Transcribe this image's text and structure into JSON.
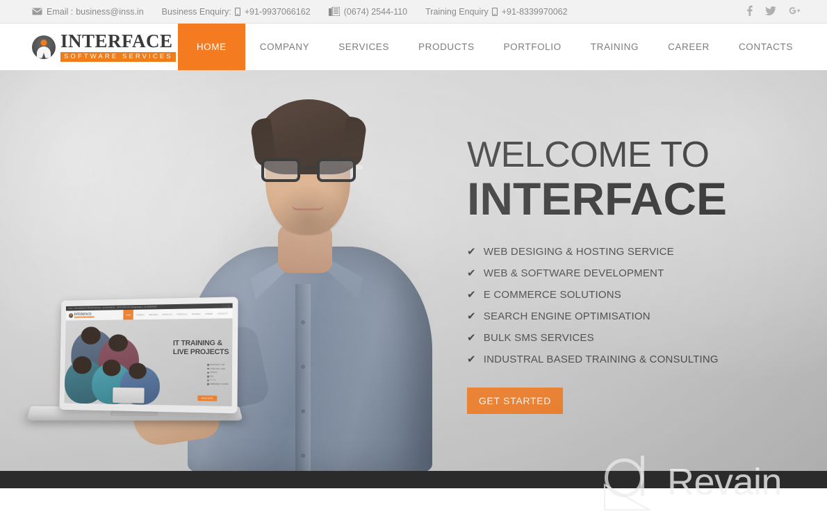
{
  "topbar": {
    "email_label": "Email :",
    "email_value": "business@inss.in",
    "business_label": "Business Enquiry:",
    "business_value": "+91-9937066162",
    "landline_value": "(0674) 2544-110",
    "training_label": "Training Enquiry",
    "training_value": "+91-8339970062",
    "social": [
      {
        "name": "facebook-icon",
        "glyph": "f"
      },
      {
        "name": "twitter-icon",
        "glyph": "ᵗ"
      },
      {
        "name": "google-plus-icon",
        "glyph": "g+"
      }
    ]
  },
  "logo": {
    "title": "INTERFACE",
    "subtitle": "SOFTWARE SERVICES"
  },
  "nav": {
    "items": [
      {
        "label": "HOME",
        "active": true
      },
      {
        "label": "COMPANY",
        "active": false
      },
      {
        "label": "SERVICES",
        "active": false
      },
      {
        "label": "PRODUCTS",
        "active": false
      },
      {
        "label": "PORTFOLIO",
        "active": false
      },
      {
        "label": "TRAINING",
        "active": false
      },
      {
        "label": "CAREER",
        "active": false
      },
      {
        "label": "CONTACTS",
        "active": false
      }
    ]
  },
  "hero": {
    "headline_line1": "WELCOME TO",
    "headline_line2": "INTERFACE",
    "features": [
      "WEB DESIGING & HOSTING SERVICE",
      "WEB & SOFTWARE DEVELOPMENT",
      "E COMMERCE SOLUTIONS",
      "SEARCH ENGINE OPTIMISATION",
      "BULK SMS SERVICES",
      "INDUSTRAL BASED TRAINING & CONSULTING"
    ],
    "tick": "✔",
    "cta_label": "GET STARTED"
  },
  "laptop_screen": {
    "topbar_text": "Email : business@inss.in   Business Enquiry: +91-9937066162",
    "topbar_text2": "(0674) 2544-110   Training Enquiry +91-8339970062",
    "logo_title": "INTERFACE",
    "logo_sub": "SOFTWARE SERVICES",
    "menu": [
      "HOME",
      "COMPANY",
      "SERVICES",
      "PRODUCTS",
      "PORTFOLIO",
      "TRAINING",
      "CAREER",
      "CONTACTS"
    ],
    "title_line1": "IT TRAINING &",
    "title_line2": "LIVE PROJECTS",
    "bullets": [
      "MICROSOFT .NET",
      "CORE JAVA / J2EE",
      "ORACLE",
      "PHP",
      "C / C++",
      "EMBEDDED SYSTEMS"
    ],
    "cta_label": "READ MORE"
  },
  "watermark": {
    "text": "Revain"
  },
  "colors": {
    "accent_orange": "#f47b20",
    "logo_orange": "#f07d1a",
    "topbar_bg": "#f2f2f2",
    "topbar_text": "#8a8a8a",
    "nav_text": "#7d7d7d",
    "dark_bar": "#2b2b2b",
    "headline": "#3a3a3a",
    "brand_headline": "#2e2e2e"
  }
}
